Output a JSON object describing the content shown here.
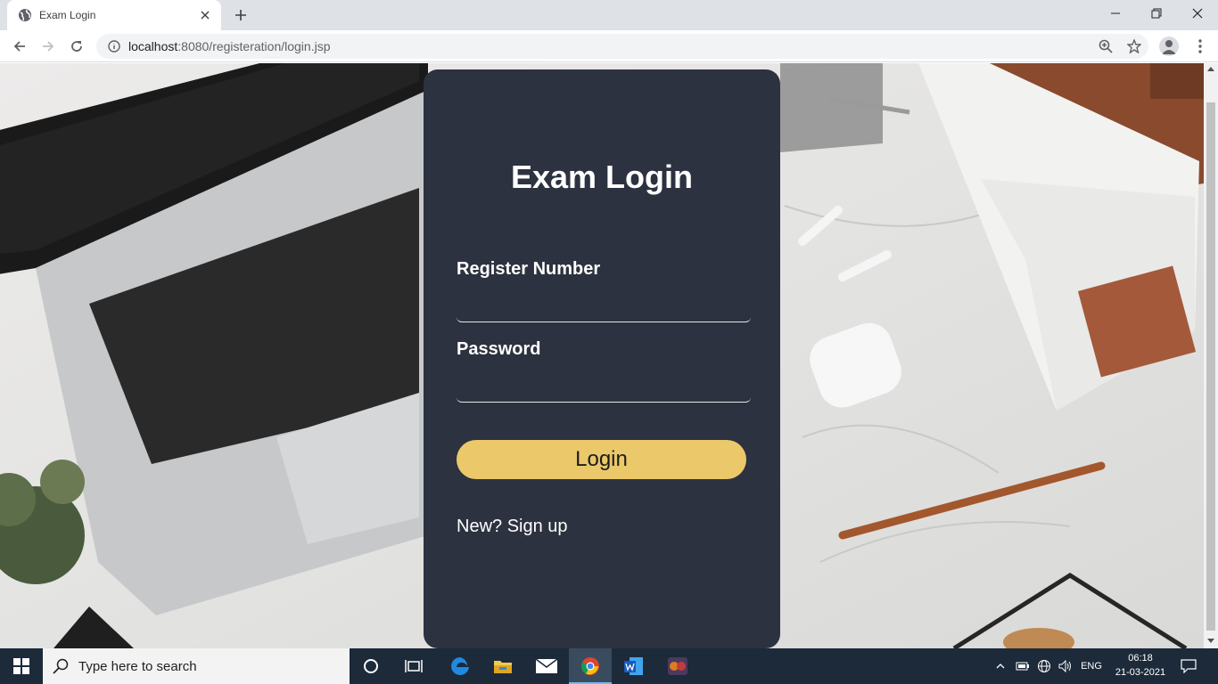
{
  "browser": {
    "tab_title": "Exam Login",
    "url_host": "localhost",
    "url_rest": ":8080/registeration/login.jsp"
  },
  "login": {
    "heading": "Exam Login",
    "register_label": "Register Number",
    "register_value": "",
    "password_label": "Password",
    "password_value": "",
    "button_label": "Login",
    "signup_link": "New? Sign up"
  },
  "colors": {
    "card_bg": "#2d3240",
    "button_bg": "#ebc86a",
    "taskbar_bg": "#1c2a3a"
  },
  "taskbar": {
    "search_placeholder": "Type here to search",
    "language": "ENG",
    "time": "06:18",
    "date": "21-03-2021",
    "apps": [
      "cortana-icon",
      "task-view-icon",
      "edge-icon",
      "file-explorer-icon",
      "mail-icon",
      "chrome-icon",
      "word-icon",
      "game-icon"
    ]
  }
}
